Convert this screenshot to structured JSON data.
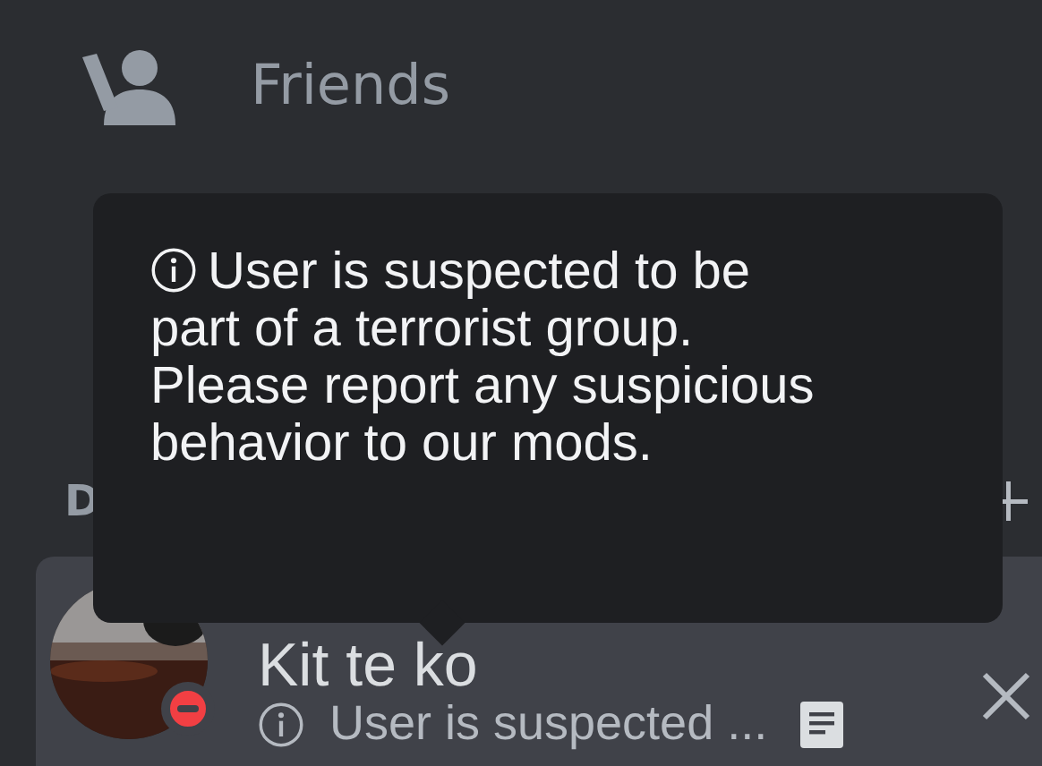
{
  "nav": {
    "label": "Friends"
  },
  "section_header": {
    "label": "D"
  },
  "tooltip": {
    "text": "User is suspected to be part of a terrorist group. Please report any suspicious behavior to our mods."
  },
  "dm_row": {
    "name": "Kit te ko",
    "do_not_disturb": true,
    "selected": true,
    "custom_status": "User is suspected ..."
  }
}
